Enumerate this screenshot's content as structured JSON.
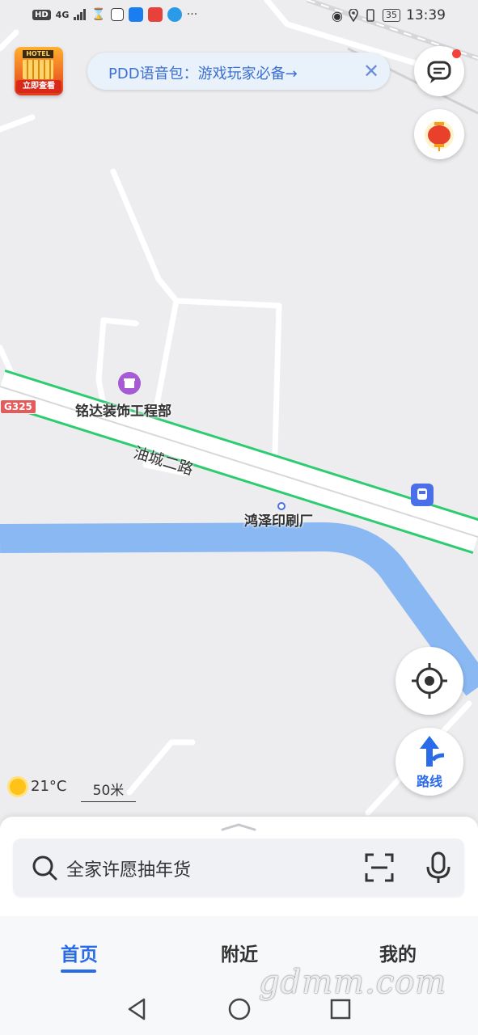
{
  "status_bar": {
    "hd": "HD",
    "network": "4G",
    "battery": "35",
    "time": "13:39"
  },
  "banner": {
    "hotel_sign": "HOTEL",
    "hotel_label": "立即查看",
    "voice_text": "PDD语音包：游戏玩家必备→",
    "close_symbol": "✕"
  },
  "map": {
    "highway_badge": "G325",
    "poi_decoration": "铭达装饰工程部",
    "poi_printing": "鸿泽印刷厂",
    "road_name": "油城二路",
    "temperature": "21°C",
    "scale": "50米"
  },
  "route_button": {
    "label": "路线"
  },
  "search": {
    "placeholder": "全家许愿抽年货"
  },
  "tabs": [
    {
      "label": "首页",
      "active": true
    },
    {
      "label": "附近",
      "active": false
    },
    {
      "label": "我的",
      "active": false
    }
  ],
  "watermark": "gdmm.com",
  "colors": {
    "accent": "#2a6be8",
    "highway_green": "#2ecc71",
    "river": "#8ab8f2",
    "poi_purple": "#a65ad6"
  }
}
